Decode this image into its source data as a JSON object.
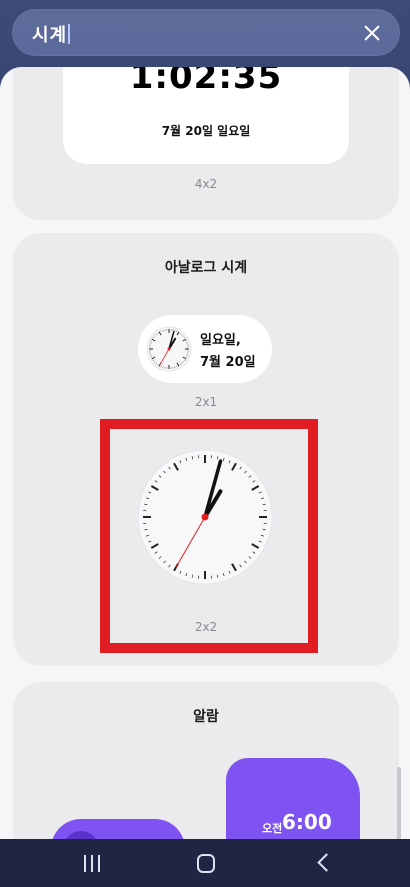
{
  "search": {
    "query": "시계"
  },
  "widgets": {
    "digital_clock": {
      "time": "1:02:35",
      "date": "7월 20일 일요일",
      "size": "4x2"
    },
    "analog_clock": {
      "title": "아날로그 시계",
      "small": {
        "weekday": "일요일,",
        "date": "7월 20일",
        "size": "2x1"
      },
      "large": {
        "size": "2x2"
      },
      "hands": {
        "hour": 1,
        "minute": 2,
        "second": 35
      },
      "accent_color": "#e11d23"
    },
    "alarm": {
      "title": "알람",
      "ampm": "오전",
      "time": "6:00",
      "accent_color": "#7f52f2"
    }
  },
  "navbar": {
    "icons": [
      "recent-apps-icon",
      "home-icon",
      "back-icon"
    ]
  }
}
